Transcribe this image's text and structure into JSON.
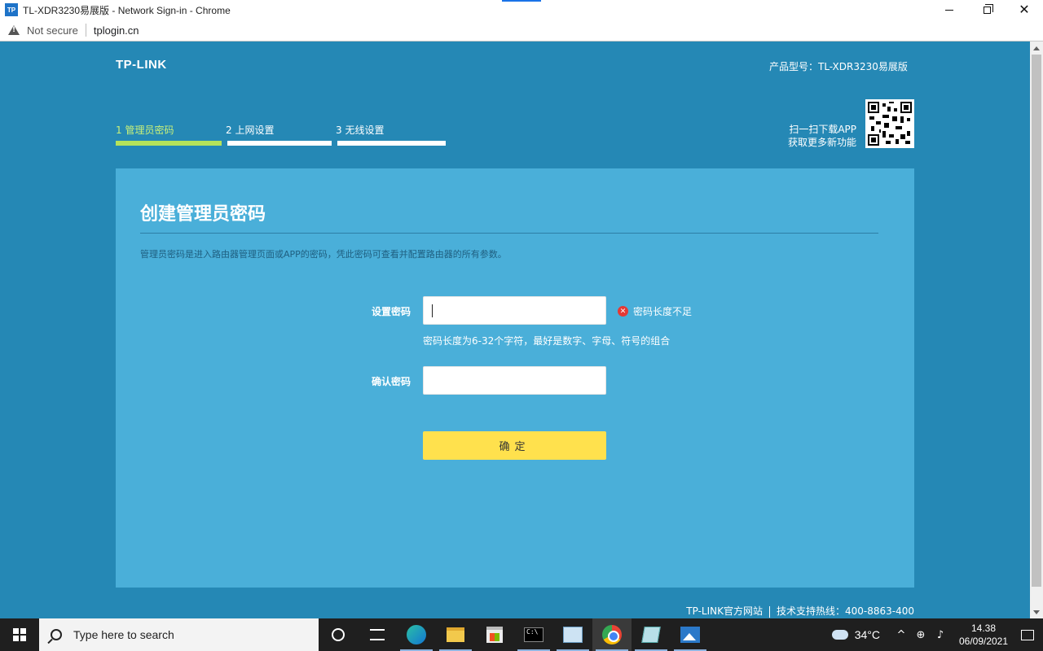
{
  "window": {
    "title": "TL-XDR3230易展版 - Network Sign-in - Chrome",
    "app_icon_text": "TP"
  },
  "addressbar": {
    "security_label": "Not secure",
    "url": "tplogin.cn"
  },
  "header": {
    "logo": "TP-LINK",
    "model": "产品型号：TL-XDR3230易展版"
  },
  "steps": [
    {
      "label": "1 管理员密码",
      "active": true
    },
    {
      "label": "2 上网设置",
      "active": false
    },
    {
      "label": "3 无线设置",
      "active": false
    }
  ],
  "app_promo": {
    "line1": "扫一扫下载APP",
    "line2": "获取更多新功能"
  },
  "form": {
    "title": "创建管理员密码",
    "description": "管理员密码是进入路由器管理页面或APP的密码，凭此密码可查看并配置路由器的所有参数。",
    "password_label": "设置密码",
    "password_value": "",
    "password_error": "密码长度不足",
    "password_hint": "密码长度为6-32个字符，最好是数字、字母、符号的组合",
    "confirm_label": "确认密码",
    "confirm_value": "",
    "submit_label": "确定"
  },
  "footer": {
    "site_link": "TP-LINK官方网站",
    "hotline": "技术支持热线：400-8863-400"
  },
  "taskbar": {
    "search_placeholder": "Type here to search",
    "temperature": "34°C",
    "time": "14.38",
    "date": "06/09/2021"
  },
  "colors": {
    "page_bg": "#2588b5",
    "card_bg": "#4aafd9",
    "active_step": "#b5e35a",
    "button": "#ffe14d",
    "error": "#e53935"
  }
}
